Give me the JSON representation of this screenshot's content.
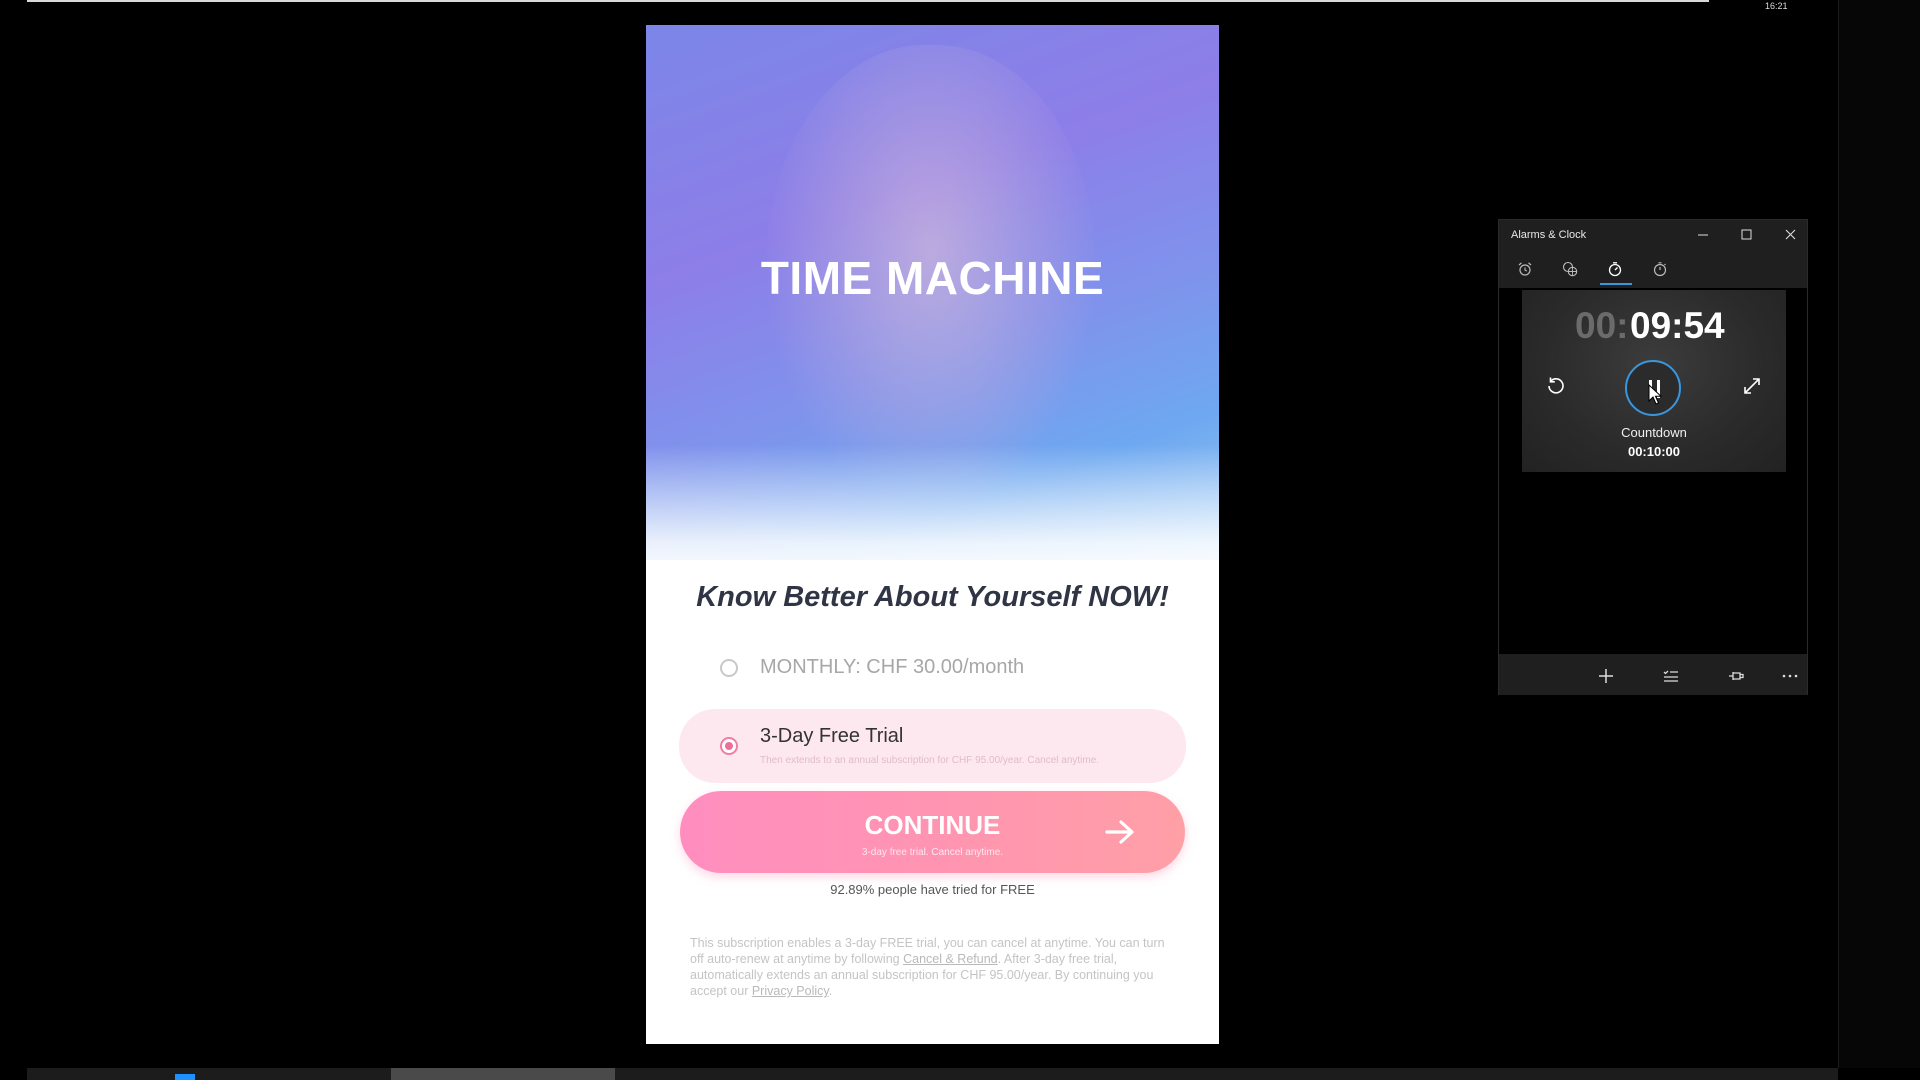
{
  "phone_app": {
    "title": "TIME MACHINE",
    "headline": "Know Better About Yourself NOW!",
    "plans": {
      "monthly": {
        "label": "MONTHLY: CHF 30.00/month",
        "selected": false
      },
      "trial": {
        "label": "3-Day Free Trial",
        "sublabel": "Then extends to an annual subscription for CHF 95.00/year. Cancel anytime.",
        "selected": true
      }
    },
    "cta": {
      "label": "CONTINUE",
      "sublabel": "3-day free trial. Cancel anytime."
    },
    "social_proof": "92.89% people have tried for FREE",
    "legal": {
      "text_1": "This subscription enables a 3-day FREE trial, you can cancel at anytime. You can turn off auto-renew at anytime by following ",
      "link_1": "Cancel & Refund",
      "text_2": ". After 3-day free trial, automatically extends an annual subscription for CHF 95.00/year. By continuing you accept our ",
      "link_2": "Privacy Policy",
      "text_3": "."
    },
    "colors": {
      "accent_pink": "#ff8ebf",
      "hero_gradient_start": "#7c86e8",
      "hero_gradient_end": "#9ccaf5"
    }
  },
  "clock_window": {
    "title": "Alarms & Clock",
    "tabs": [
      {
        "name": "alarm",
        "icon": "alarm-clock-icon",
        "active": false
      },
      {
        "name": "world-clock",
        "icon": "globe-clock-icon",
        "active": false
      },
      {
        "name": "timer",
        "icon": "timer-icon",
        "active": true
      },
      {
        "name": "stopwatch",
        "icon": "stopwatch-icon",
        "active": false
      }
    ],
    "timer": {
      "hours": "00:",
      "minutes_seconds": "09:54",
      "name": "Countdown",
      "total": "00:10:00",
      "state": "running"
    },
    "bottom_actions": [
      "add-icon",
      "select-list-icon",
      "pin-icon",
      "more-icon"
    ],
    "colors": {
      "accent": "#3a96dd"
    }
  },
  "taskbar": {
    "clock": "16:21"
  }
}
